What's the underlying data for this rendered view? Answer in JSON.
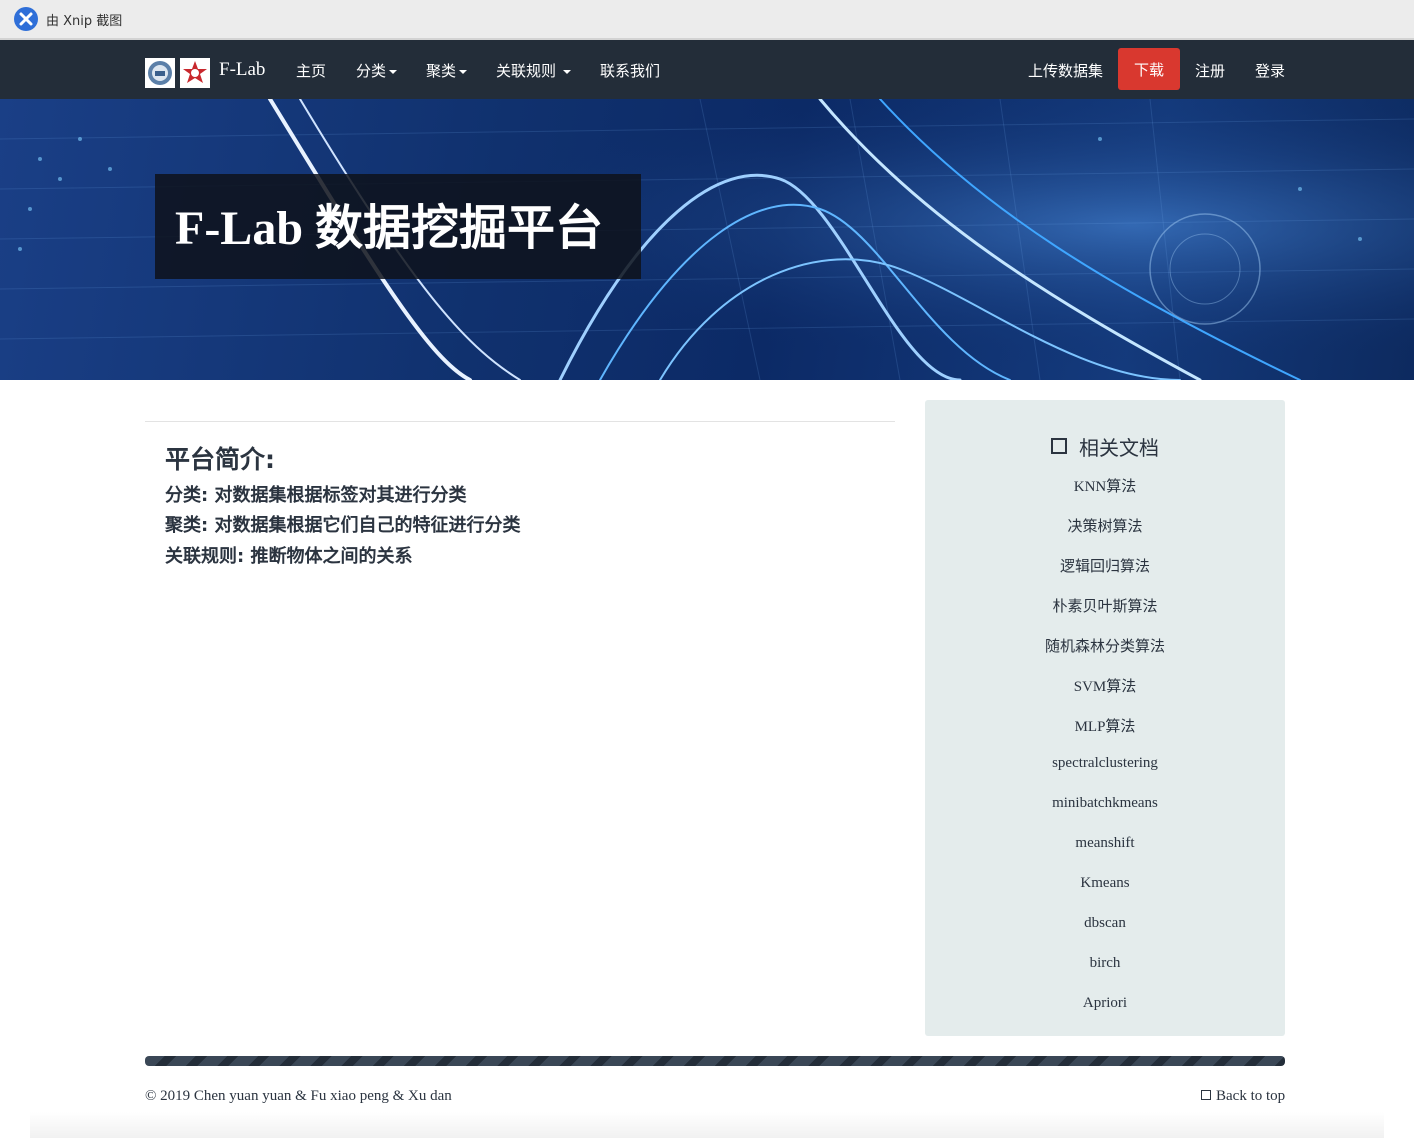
{
  "xnip": {
    "label": "由 Xnip 截图"
  },
  "navbar": {
    "brand": "F-Lab",
    "items": [
      {
        "label": "主页",
        "caret": false
      },
      {
        "label": "分类",
        "caret": true
      },
      {
        "label": "聚类",
        "caret": true
      },
      {
        "label": "关联规则",
        "caret": true
      },
      {
        "label": "联系我们",
        "caret": false
      }
    ],
    "upload": "上传数据集",
    "download": "下载",
    "register": "注册",
    "login": "登录",
    "download_color": "#d9382f"
  },
  "hero": {
    "title": "F-Lab 数据挖掘平台"
  },
  "intro": {
    "title": "平台简介:",
    "lines": [
      "分类: 对数据集根据标签对其进行分类",
      "聚类: 对数据集根据它们自己的特征进行分类",
      "关联规则: 推断物体之间的关系"
    ]
  },
  "sidebar": {
    "title": "相关文档",
    "links": [
      "KNN算法",
      "决策树算法",
      "逻辑回归算法",
      "朴素贝叶斯算法",
      "随机森林分类算法",
      "SVM算法",
      "MLP算法",
      "spectralclustering",
      "minibatchkmeans",
      "meanshift",
      "Kmeans",
      "dbscan",
      "birch",
      "Apriori"
    ]
  },
  "footer": {
    "copyright": "©  2019 Chen yuan yuan & Fu xiao peng & Xu dan",
    "back_to_top": "Back to top"
  }
}
